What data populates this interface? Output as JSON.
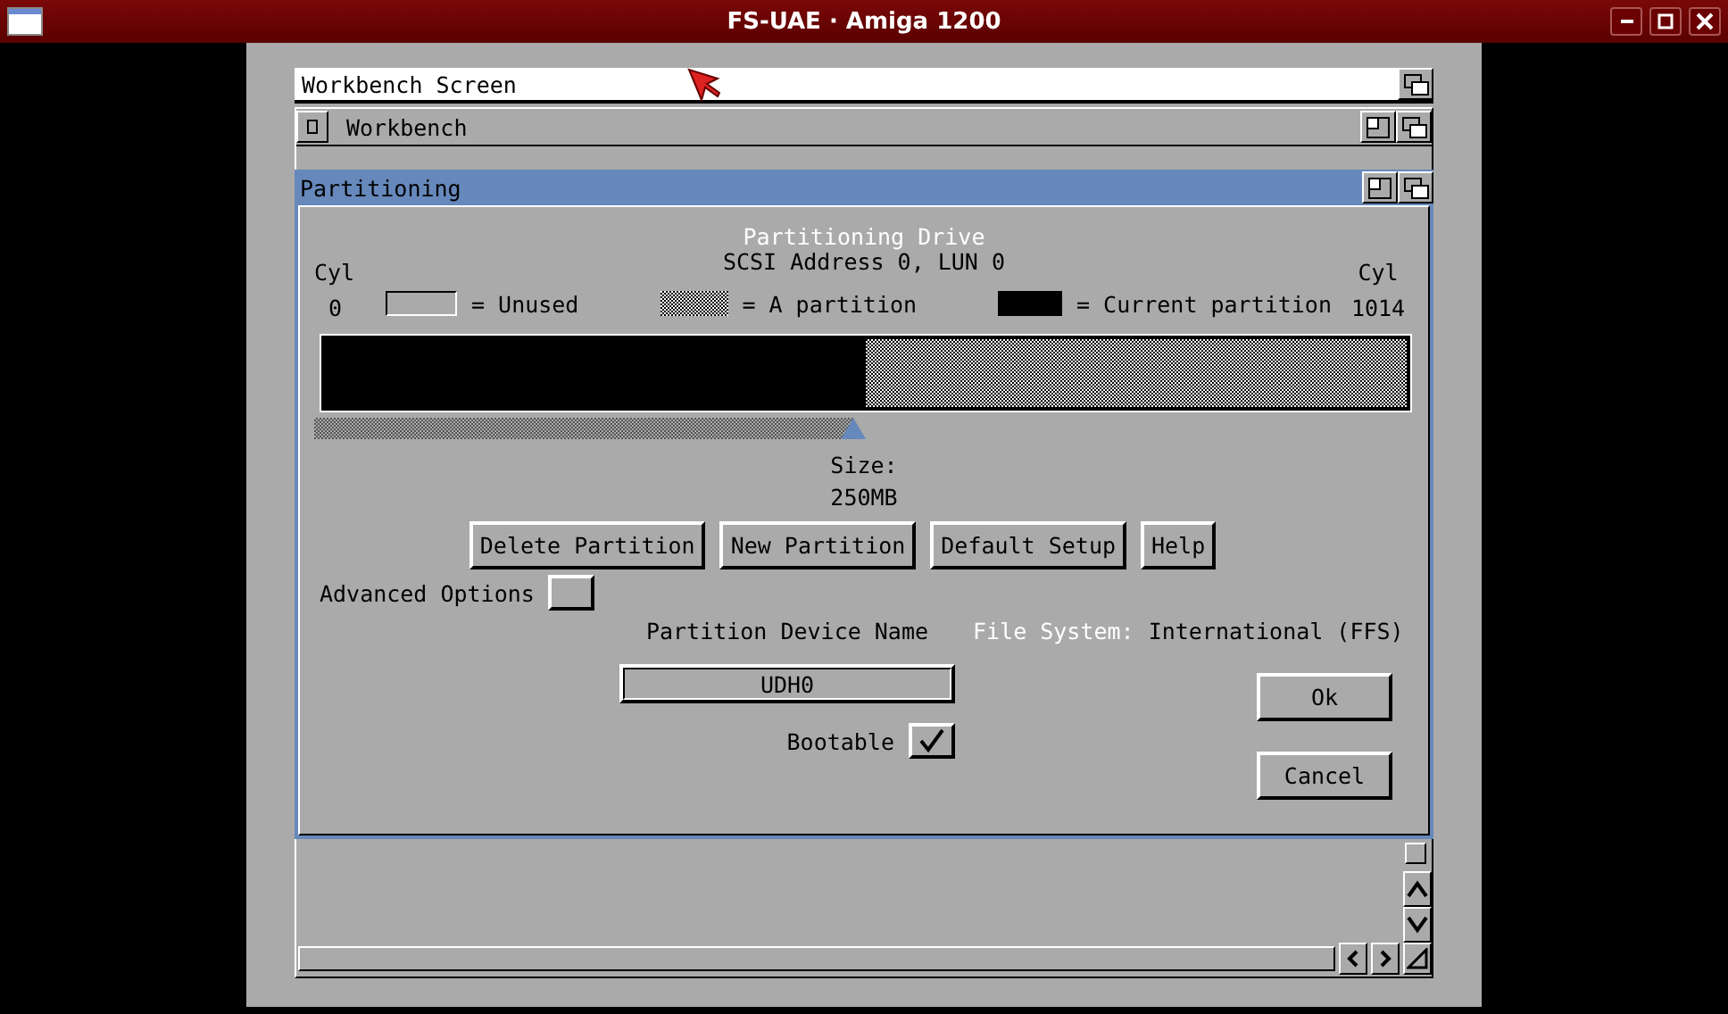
{
  "host_window": {
    "title": "FS-UAE · Amiga 1200"
  },
  "screen": {
    "title": "Workbench Screen"
  },
  "workbench_window": {
    "title": "Workbench"
  },
  "dialog": {
    "title": "Partitioning",
    "heading": "Partitioning Drive",
    "address": "SCSI Address 0, LUN 0",
    "cyl_start": {
      "label": "Cyl",
      "value": "0"
    },
    "cyl_end": {
      "label": "Cyl",
      "value": "1014"
    },
    "legend": [
      {
        "kind": "unused",
        "label": "= Unused"
      },
      {
        "kind": "partition",
        "label": "= A partition"
      },
      {
        "kind": "current",
        "label": "= Current partition"
      }
    ],
    "drive_map": {
      "level": 0.5
    },
    "size_slider": {
      "level": 0.5
    },
    "size_label": "Size:",
    "size_value": "250MB",
    "buttons": [
      "Delete Partition",
      "New Partition",
      "Default Setup",
      "Help"
    ],
    "advanced_options": {
      "label": "Advanced Options",
      "checked": false
    },
    "device_name_label": "Partition Device Name",
    "file_system_label": "File System:",
    "file_system_value": "International (FFS)",
    "device_name": {
      "value": "UDH0"
    },
    "bootable": {
      "label": "Bootable",
      "checked": true
    },
    "ok": "Ok",
    "cancel": "Cancel"
  }
}
